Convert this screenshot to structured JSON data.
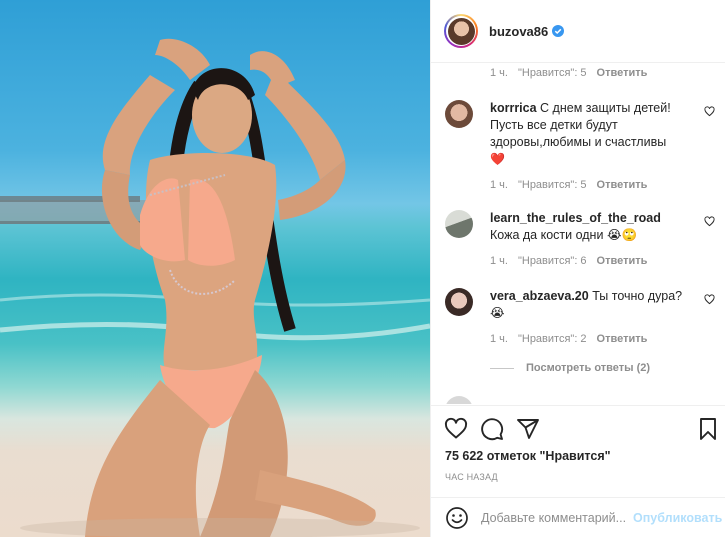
{
  "post": {
    "author": "buzova86",
    "verified": true,
    "photo_alt": ""
  },
  "comments": [
    {
      "partial": true,
      "time": "1 ч.",
      "likes": "\"Нравится\": 5",
      "reply": "Ответить"
    },
    {
      "user": "korrrica",
      "text": "С днем защиты детей! Пусть все детки будут здоровы,любимы и счастливы",
      "emoji": "❤️",
      "time": "1 ч.",
      "likes": "\"Нравится\": 5",
      "reply": "Ответить",
      "avatar_color": "#b59486"
    },
    {
      "user": "learn_the_rules_of_the_road",
      "text": "Кожа да кости одни",
      "emoji": "😭🙄",
      "time": "1 ч.",
      "likes": "\"Нравится\": 6",
      "reply": "Ответить",
      "avatar_color": "#8c9388"
    },
    {
      "user": "vera_abzaeva.20",
      "text": "Ты точно дура?",
      "emoji": "😭",
      "time": "1 ч.",
      "likes": "\"Нравится\": 2",
      "reply": "Ответить",
      "avatar_color": "#c9a79a"
    }
  ],
  "view_replies": "Посмотреть ответы (2)",
  "likes_count": "75 622 отметок \"Нравится\"",
  "time_ago": "ЧАС НАЗАД",
  "add_comment": {
    "placeholder": "Добавьте комментарий...",
    "post_label": "Опубликовать"
  },
  "icons": {
    "like": "heart-icon",
    "comment": "comment-icon",
    "share": "paper-plane-icon",
    "save": "bookmark-icon",
    "emoji": "smiley-icon",
    "verified": "verified-badge-icon"
  },
  "colors": {
    "verified_blue": "#3897f0",
    "heart_red": "#ed4956",
    "publish_disabled": "#b2dffc"
  }
}
